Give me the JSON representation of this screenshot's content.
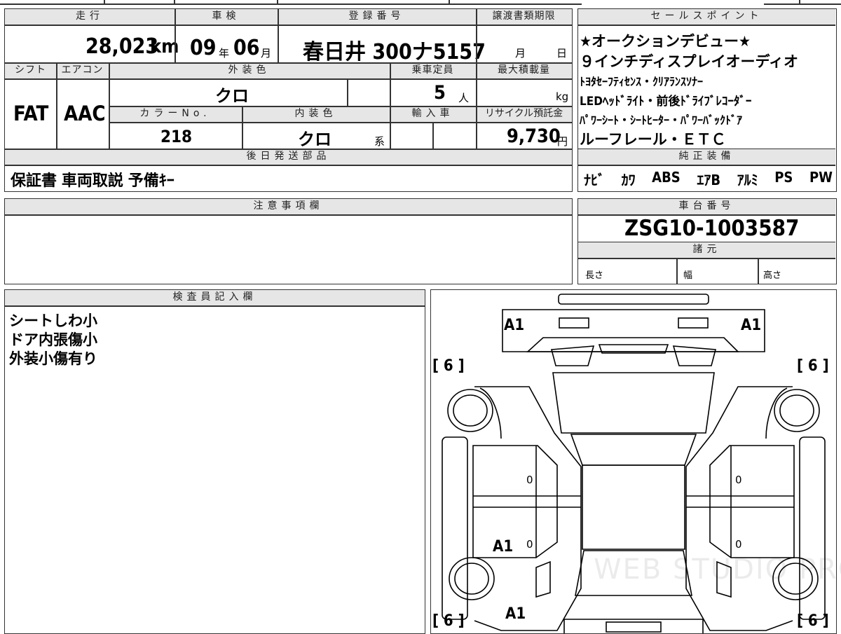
{
  "header": {
    "mileage_label": "走行",
    "mileage_value": "28,023",
    "mileage_unit": "km",
    "inspection_label": "車検",
    "inspection_year": "09",
    "year_unit": "年",
    "inspection_month": "06",
    "month_unit": "月",
    "registration_label": "登録番号",
    "registration_value": "春日井 300ナ5157",
    "transfer_label": "譲渡書類期限",
    "transfer_month_unit": "月",
    "transfer_day_unit": "日"
  },
  "specs": {
    "shift_label": "シフト",
    "shift_value": "FAT",
    "ac_label": "エアコン",
    "ac_value": "AAC",
    "exterior_label": "外装色",
    "exterior_value": "クロ",
    "capacity_label": "乗車定員",
    "capacity_value": "5",
    "capacity_unit": "人",
    "load_label": "最大積載量",
    "load_unit": "kg",
    "color_no_label": "カラーNo.",
    "color_no_value": "218",
    "interior_label": "内装色",
    "interior_value": "クロ",
    "interior_suffix": "系",
    "import_label": "輸入車",
    "recycle_label": "リサイクル預託金",
    "recycle_value": "9,730",
    "recycle_unit": "円"
  },
  "later_parts": {
    "label": "後日発送部品",
    "value": "保証書 車両取説 予備ｷｰ"
  },
  "sales_points": {
    "label": "セールスポイント",
    "lines": [
      "★オークションデビュー★",
      "９インチディスプレイオーディオ",
      "ﾄﾖﾀｾｰﾌﾃｨｾﾝｽ・ｸﾘｱﾗﾝｽｿﾅｰ",
      "LEDﾍｯﾄﾞﾗｲﾄ・前後ﾄﾞﾗｲﾌﾞﾚｺｰﾀﾞｰ",
      "ﾊﾟﾜｰｼｰﾄ・ｼｰﾄﾋｰﾀｰ・ﾊﾟﾜｰﾊﾞｯｸﾄﾞｱ",
      "ルーフレール・ＥＴＣ"
    ]
  },
  "equipment": {
    "label": "純正装備",
    "items": [
      "ﾅﾋﾞ",
      "ｶﾜ",
      "ABS",
      "ｴｱB",
      "ｱﾙﾐ",
      "PS",
      "PW"
    ]
  },
  "notes": {
    "label": "注意事項欄"
  },
  "chassis": {
    "label": "車台番号",
    "value": "ZSG10-1003587"
  },
  "dimensions": {
    "label": "諸元",
    "length": "長さ",
    "width": "幅",
    "height": "高さ"
  },
  "inspector": {
    "label": "検査員記入欄",
    "lines": [
      "シートしわ小",
      "ドア内張傷小",
      "外装小傷有り"
    ]
  },
  "diagram": {
    "marks": {
      "front_left": "A1",
      "front_right": "A1",
      "rear_door_left": "A1",
      "rear_left": "A1",
      "front_tire_left": "[ 6 ]",
      "front_tire_right": "[ 6 ]",
      "rear_tire_left": "[ 6 ]",
      "rear_tire_right": "[ 6 ]",
      "door_fl": "0",
      "door_fr": "0",
      "door_rl": "0",
      "door_rr": "0"
    },
    "watermark": "WEB STUDIO PRO"
  }
}
